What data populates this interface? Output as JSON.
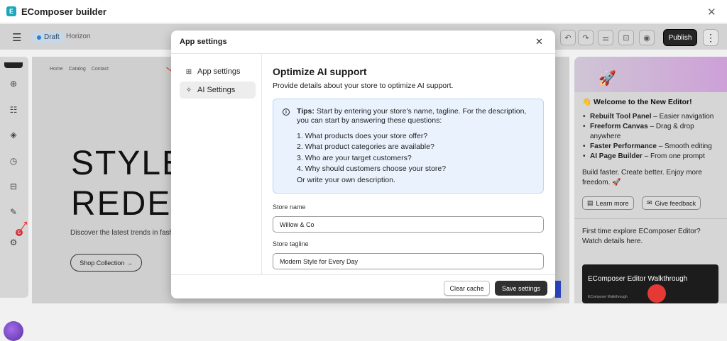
{
  "window": {
    "title": "EComposer builder",
    "logo": "E"
  },
  "topbar": {
    "status": "Draft",
    "theme": "Horizon",
    "publish_label": "Publish"
  },
  "leftbar": {
    "badge_count": "6"
  },
  "canvas": {
    "nav": [
      "Home",
      "Catalog",
      "Contact"
    ],
    "headline_line1": "STYLE",
    "headline_line2": "REDEFI",
    "discover": "Discover the latest trends in fash",
    "shop_button": "Shop Collection →"
  },
  "right_panel": {
    "welcome": "👋 Welcome to the New Editor!",
    "features": [
      {
        "bold": "Rebuilt Tool Panel",
        "text": " – Easier navigation"
      },
      {
        "bold": "Freeform Canvas",
        "text": " – Drag & drop anywhere"
      },
      {
        "bold": "Faster Performance",
        "text": " – Smooth editing"
      },
      {
        "bold": "AI Page Builder",
        "text": " – From one prompt"
      }
    ],
    "tagline": "Build faster. Create better. Enjoy more freedom. 🚀",
    "learn_more": "Learn more",
    "give_feedback": "Give feedback",
    "first_time": "First time explore EComposer Editor? Watch details here.",
    "video_title": "EComposer Editor Walkthrough",
    "video_sub": "EComposer Walkthrough"
  },
  "modal": {
    "title": "App settings",
    "sidebar": [
      {
        "label": "App settings",
        "icon": "grid-icon"
      },
      {
        "label": "AI Settings",
        "icon": "sparkle-icon"
      }
    ],
    "heading": "Optimize AI support",
    "subheading": "Provide details about your store to optimize AI support.",
    "tips_label": "Tips:",
    "tips_text": " Start by entering your store's name, tagline. For the description, you can start by answering these questions:",
    "tips_questions": [
      "1. What products does your store offer?",
      "2. What product categories are available?",
      "3. Who are your target customers?",
      "4. Why should customers choose your store?"
    ],
    "tips_own": "Or write your own description.",
    "store_name_label": "Store name",
    "store_name_value": "Willow & Co",
    "store_tagline_label": "Store tagline",
    "store_tagline_value": "Modern Style for Every Day",
    "clear_cache": "Clear cache",
    "save_settings": "Save settings"
  }
}
